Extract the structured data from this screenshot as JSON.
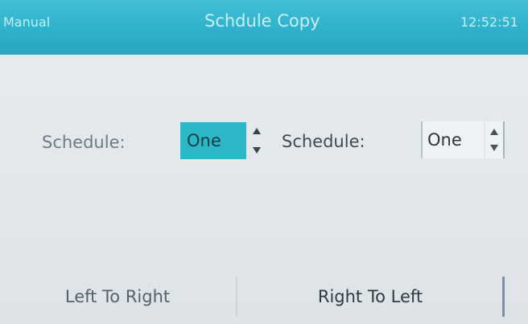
{
  "header": {
    "mode": "Manual",
    "title": "Schdule Copy",
    "time": "12:52:51"
  },
  "left": {
    "label": "Schedule:",
    "value": "One"
  },
  "right": {
    "label": "Schedule:",
    "value": "One"
  },
  "actions": {
    "left_to_right": "Left To Right",
    "right_to_left": "Right To Left"
  },
  "icons": {
    "up": "triangle-up-icon",
    "down": "triangle-down-icon"
  },
  "colors": {
    "titlebar": "#2fb1cb",
    "selected_field": "#2bb7c5",
    "background": "#e4eaee"
  }
}
